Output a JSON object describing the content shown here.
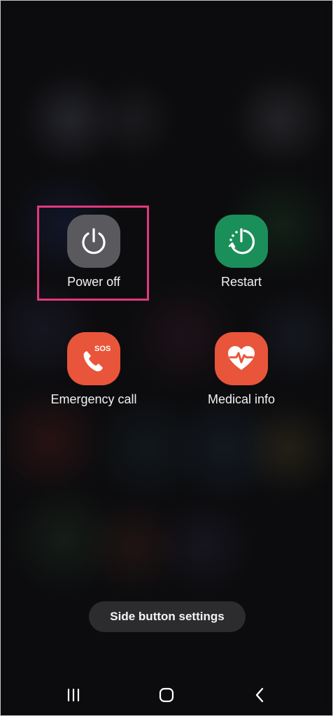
{
  "actions": {
    "power_off": {
      "label": "Power off",
      "color": "#5a5a5e",
      "icon": "power-icon"
    },
    "restart": {
      "label": "Restart",
      "color": "#1a8f5a",
      "icon": "restart-icon"
    },
    "emergency_call": {
      "label": "Emergency call",
      "color": "#e9553a",
      "icon": "sos-phone-icon",
      "badge": "SOS"
    },
    "medical_info": {
      "label": "Medical info",
      "color": "#e9553a",
      "icon": "heart-pulse-icon"
    }
  },
  "highlight_color": "#e4387f",
  "side_button_settings": {
    "label": "Side button settings"
  },
  "navigation_bar": {
    "recents": "recents-icon",
    "home": "home-icon",
    "back": "back-icon"
  }
}
